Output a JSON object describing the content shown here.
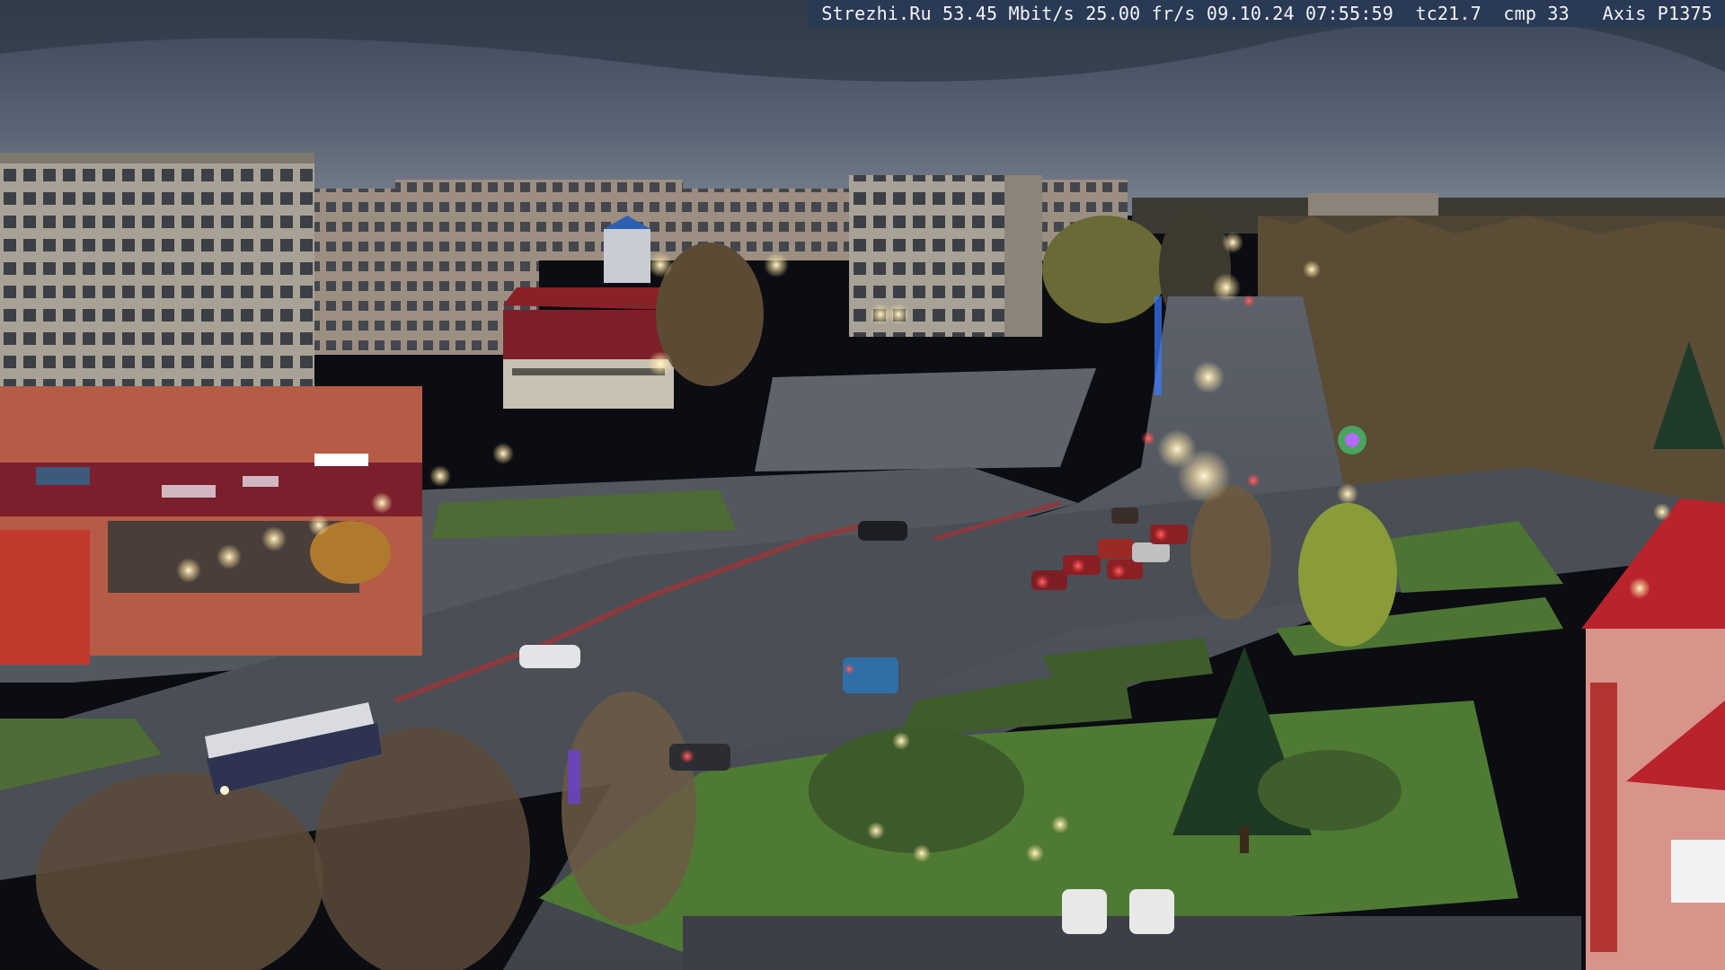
{
  "overlay": {
    "site": "Strezhi.Ru",
    "bitrate": "53.45 Mbit/s",
    "framerate": "25.00 fr/s",
    "datetime": "09.10.24 07:55:59",
    "tc": "tc21.7",
    "cmp": "cmp 33",
    "camera_model": "Axis P1375"
  },
  "scene": {
    "description_type": "street-webcam",
    "sky_color": "#4a5568",
    "road_color": "#4b4f57",
    "grass_color": "#4f7a34"
  }
}
